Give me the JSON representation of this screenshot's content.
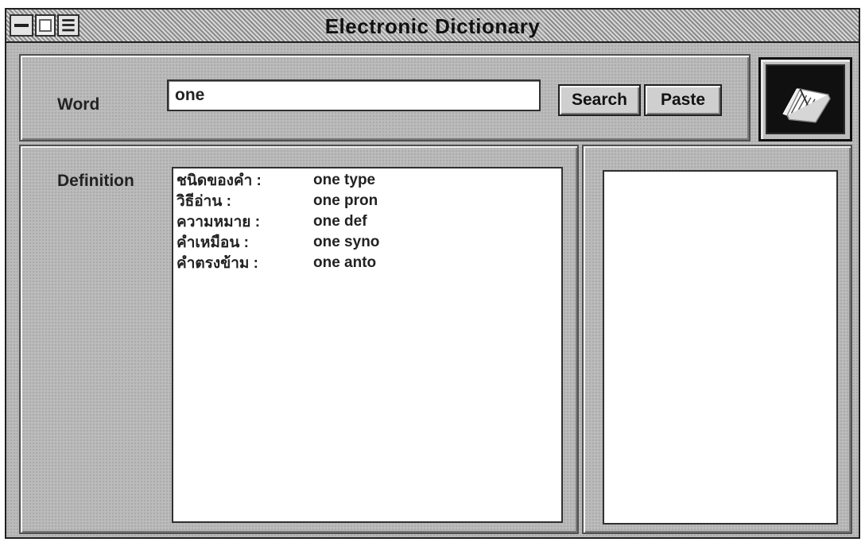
{
  "window": {
    "title": "Electronic Dictionary"
  },
  "search": {
    "label": "Word",
    "value": "one",
    "search_label": "Search",
    "paste_label": "Paste"
  },
  "definition": {
    "label": "Definition",
    "rows": [
      {
        "key": "ชนิดของคำ :",
        "value": "one type"
      },
      {
        "key": "วิธีอ่าน :",
        "value": "one pron"
      },
      {
        "key": "ความหมาย :",
        "value": "one def"
      },
      {
        "key": "คำเหมือน :",
        "value": "one syno"
      },
      {
        "key": "คำตรงข้าม :",
        "value": "one anto"
      }
    ]
  },
  "icons": {
    "system_menu": "minus-bar-icon",
    "document": "document-icon",
    "menu": "e-menu-icon",
    "book": "open-book-icon"
  },
  "colors": {
    "window_bg": "#bcbcbc",
    "title_bg": "#9e9e9e",
    "text": "#222222",
    "field_bg": "#ffffff"
  }
}
